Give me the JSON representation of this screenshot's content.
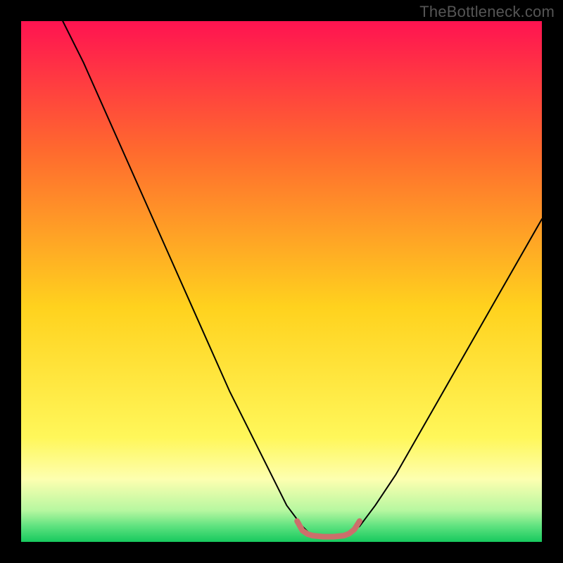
{
  "watermark": "TheBottleneck.com",
  "chart_data": {
    "type": "line",
    "title": "",
    "xlabel": "",
    "ylabel": "",
    "xlim": [
      0,
      100
    ],
    "ylim": [
      0,
      100
    ],
    "grid": false,
    "legend": false,
    "background_gradient": {
      "stops": [
        {
          "pos": 0.0,
          "color": "#ff1351"
        },
        {
          "pos": 0.25,
          "color": "#ff6a2e"
        },
        {
          "pos": 0.55,
          "color": "#ffd21e"
        },
        {
          "pos": 0.8,
          "color": "#fff75a"
        },
        {
          "pos": 0.88,
          "color": "#fdffb0"
        },
        {
          "pos": 0.94,
          "color": "#b6f7a0"
        },
        {
          "pos": 0.97,
          "color": "#5ee27f"
        },
        {
          "pos": 1.0,
          "color": "#17c95e"
        }
      ]
    },
    "series": [
      {
        "name": "bottleneck-curve",
        "stroke": "#000000",
        "stroke_width": 2,
        "x": [
          8,
          12,
          16,
          20,
          24,
          28,
          32,
          36,
          40,
          44,
          48,
          51,
          54,
          56,
          58,
          62,
          65,
          68,
          72,
          76,
          80,
          84,
          88,
          92,
          96,
          100
        ],
        "y": [
          100,
          92,
          83,
          74,
          65,
          56,
          47,
          38,
          29,
          21,
          13,
          7,
          3,
          1,
          1,
          1,
          3,
          7,
          13,
          20,
          27,
          34,
          41,
          48,
          55,
          62
        ]
      },
      {
        "name": "optimal-range-marker",
        "stroke": "#cc6f6b",
        "stroke_width": 8,
        "x": [
          53,
          54,
          55,
          56,
          58,
          60,
          62,
          63,
          64,
          65
        ],
        "y": [
          4,
          2.2,
          1.5,
          1.2,
          1.0,
          1.0,
          1.2,
          1.6,
          2.4,
          4
        ]
      }
    ]
  }
}
